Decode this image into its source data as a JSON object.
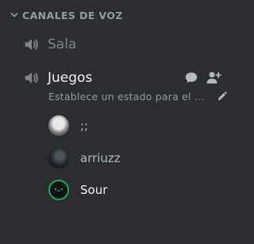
{
  "category": {
    "label": "CANALES DE VOZ"
  },
  "channels": [
    {
      "name": "Sala",
      "icon": "speaker-icon"
    },
    {
      "name": "Juegos",
      "icon": "speaker-icon",
      "status": "Establece un estado para el canal"
    }
  ],
  "users": [
    {
      "name": ";;",
      "avatar": "avatar-photo"
    },
    {
      "name": "arriuzz",
      "avatar": "avatar-photo"
    },
    {
      "name": "Sour",
      "avatar": "avatar-speaking"
    }
  ],
  "colors": {
    "background": "#2b2d31",
    "muted_text": "#80848e",
    "active_text": "#f2f3f5",
    "speaking_ring": "#23a55a"
  }
}
